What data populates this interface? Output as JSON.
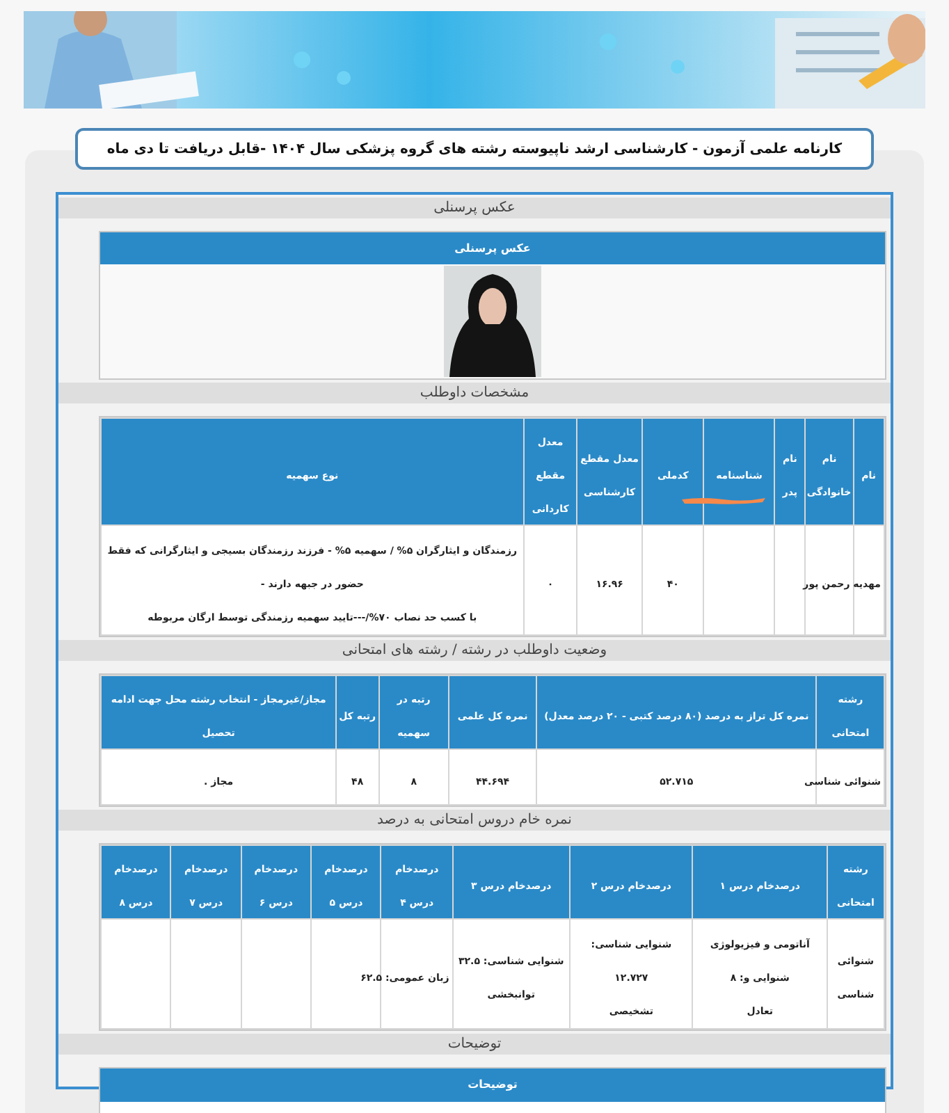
{
  "page_title": "کارنامه علمی آزمون - کارشناسی ارشد ناپیوسته رشته های گروه پزشکی سال ۱۴۰۴ -قابل دریافت تا دی ماه",
  "sections": [
    {
      "heading": "عکس پرسنلی",
      "table_header": "عکس پرسنلی"
    },
    {
      "kind": "candidate",
      "heading": "مشخصات داوطلب",
      "columns": [
        "نام",
        "نام خانوادگی",
        "نام پدر",
        "شناسنامه",
        "کدملی",
        "معدل مقطع کارشناسی",
        "معدل مقطع کاردانی",
        "نوع سهمیه"
      ],
      "rows": [
        [
          [
            "مهدیه"
          ],
          [
            "رحمن پور"
          ],
          [],
          [],
          [
            "۴۰"
          ],
          [
            "۱۶.۹۶"
          ],
          [
            "۰"
          ],
          [
            "رزمندگان و ایثارگران ۵% / سهمیه ۵% - فرزند رزمندگان بسیجی و ایثارگرانی که فقط حضور در جبهه دارند -",
            "با کسب حد نصاب ۷۰%/---تایید سهمیه رزمندگی توسط ارگان مربوطه"
          ]
        ]
      ]
    },
    {
      "kind": "status",
      "heading": "وضعیت داوطلب در رشته / رشته های امتحانی",
      "columns": [
        "رشته امتحانی",
        "نمره کل تراز به درصد (۸۰ درصد کتبی - ۲۰ درصد معدل)",
        "نمره کل علمی",
        "رتبه در سهمیه",
        "رتبه کل",
        "مجاز/غیرمجاز - انتخاب رشته محل جهت ادامه تحصیل"
      ],
      "rows": [
        [
          [
            "شنوائی شناسی"
          ],
          [
            "۵۲.۷۱۵"
          ],
          [
            "۴۴.۶۹۴"
          ],
          [
            "۸"
          ],
          [
            "۴۸"
          ],
          [
            "مجاز ."
          ]
        ]
      ]
    },
    {
      "kind": "scores",
      "heading": "نمره خام دروس امتحانی به درصد",
      "columns": [
        "رشته امتحانی",
        "درصدخام درس ۱",
        "درصدخام درس ۲",
        "درصدخام درس ۳",
        "درصدخام درس ۴",
        "درصدخام درس ۵",
        "درصدخام درس ۶",
        "درصدخام درس ۷",
        "درصدخام درس ۸"
      ],
      "rows": [
        [
          [
            "شنوائی",
            "شناسی"
          ],
          [
            "آناتومی و فیزیولوژی شنوایی و: ۸",
            "تعادل"
          ],
          [
            "شنوایی شناسی: ۱۲.۷۲۷",
            "تشخیصی"
          ],
          [
            "شنوایی شناسی: ۳۲.۵",
            "توانبخشی"
          ],
          [
            "زبان عمومی: ۶۲.۵"
          ],
          [],
          [],
          [],
          []
        ]
      ]
    },
    {
      "kind": "notes",
      "heading": "توضیحات",
      "table_header": "توضیحات"
    }
  ]
}
